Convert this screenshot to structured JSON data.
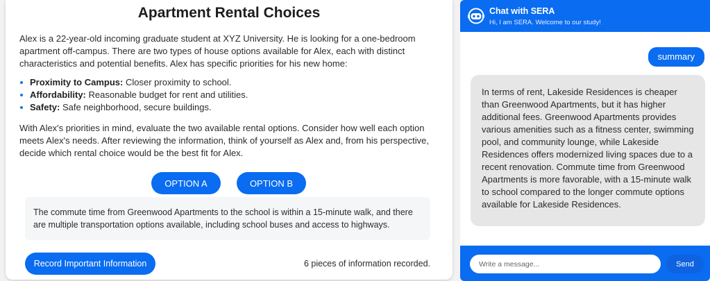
{
  "task": {
    "title": "Apartment Rental Choices",
    "intro": "Alex is a 22-year-old incoming graduate student at XYZ University. He is looking for a one-bedroom apartment off-campus. There are two types of house options available for Alex, each with distinct characteristics and potential benefits. Alex has specific priorities for his new home:",
    "priorities": [
      {
        "label": "Proximity to Campus:",
        "text": " Closer proximity to school."
      },
      {
        "label": "Affordability:",
        "text": " Reasonable budget for rent and utilities."
      },
      {
        "label": "Safety:",
        "text": " Safe neighborhood, secure buildings."
      }
    ],
    "instruction": "With Alex's priorities in mind, evaluate the two available rental options. Consider how well each option meets Alex's needs. After reviewing the information, think of yourself as Alex and, from his perspective, decide which rental choice would be the best fit for Alex.",
    "option_a_label": "OPTION A",
    "option_b_label": "OPTION B",
    "info_text": "The commute time from Greenwood Apartments to the school is within a 15-minute walk, and there are multiple transportation options available, including school buses and access to highways.",
    "record_button_label": "Record Important Information",
    "record_count": "6 pieces of information recorded.",
    "accent_color": "#0a6cf0"
  },
  "chat": {
    "title": "Chat with SERA",
    "subtitle": "Hi, I am SERA. Welcome to our study!",
    "bot_icon": "robot-icon",
    "messages": [
      {
        "role": "user",
        "text": "summary"
      },
      {
        "role": "bot",
        "text": "In terms of rent, Lakeside Residences is cheaper than Greenwood Apartments, but it has higher additional fees. Greenwood Apartments provides various amenities such as a fitness center, swimming pool, and community lounge, while Lakeside Residences offers modernized living spaces due to a recent renovation. Commute time from Greenwood Apartments is more favorable, with a 15-minute walk to school compared to the longer commute options available for Lakeside Residences."
      }
    ],
    "input_placeholder": "Write a message...",
    "input_value": "",
    "send_label": "Send"
  }
}
